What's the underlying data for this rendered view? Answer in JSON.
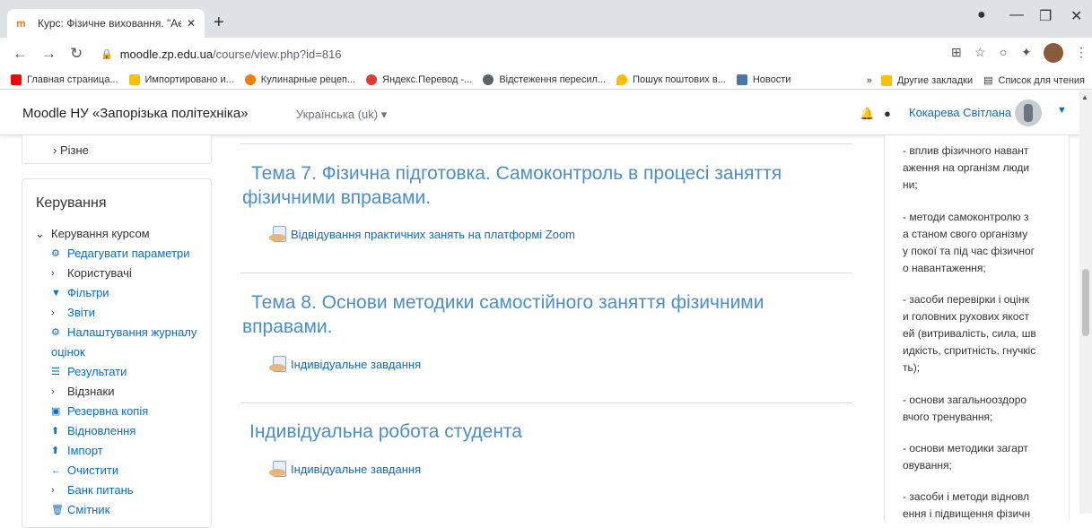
{
  "browser": {
    "tab_title": "Курс: Фізичне виховання. \"Аеро",
    "address_host": "moodle.zp.edu.ua",
    "address_path": "/course/view.php?id=816",
    "bookmarks": [
      {
        "label": "Главная страница...",
        "color": "#ff0000"
      },
      {
        "label": "Импортировано и...",
        "color": "#f4c20d"
      },
      {
        "label": "Кулинарные рецеп...",
        "color": "#f57c00"
      },
      {
        "label": "Яндекс.Перевод -...",
        "color": "#e53935"
      },
      {
        "label": "Відстеження пересил...",
        "color": "#5f6368"
      },
      {
        "label": "Пошук поштових в...",
        "color": "#fbbc04"
      },
      {
        "label": "Новости",
        "color": "#4a76a8"
      }
    ],
    "bookmarks_more": "»",
    "other_bookmarks": "Другие закладки",
    "reading_list": "Список для чтения"
  },
  "navbar": {
    "site_name": "Moodle НУ «Запорізька політехніка»",
    "language": "Українська (uk) ▾",
    "user_name": "Кокарева Світлана"
  },
  "left": {
    "prev_item": "Різне",
    "admin_title": "Керування",
    "admin_items": [
      {
        "prefix": "⌄",
        "icon": "",
        "label": "Керування курсом",
        "link": false
      },
      {
        "prefix": "",
        "icon": "⚙",
        "label": "Редагувати параметри",
        "link": true
      },
      {
        "prefix": "›",
        "icon": "",
        "label": "Користувачі",
        "link": false
      },
      {
        "prefix": "",
        "icon": "▼",
        "label": "Фільтри",
        "link": true
      },
      {
        "prefix": "›",
        "icon": "",
        "label": "Звіти",
        "link": true
      },
      {
        "prefix": "",
        "icon": "⚙",
        "label": "Налаштування журналу",
        "link": true
      },
      {
        "prefix": "",
        "icon": "",
        "label": "оцінок",
        "link": true
      },
      {
        "prefix": "",
        "icon": "☰",
        "label": "Результати",
        "link": true
      },
      {
        "prefix": "›",
        "icon": "",
        "label": "Відзнаки",
        "link": false
      },
      {
        "prefix": "",
        "icon": "▣",
        "label": "Резервна копія",
        "link": true
      },
      {
        "prefix": "",
        "icon": "⬆",
        "label": "Відновлення",
        "link": true
      },
      {
        "prefix": "",
        "icon": "⬆",
        "label": "Імпорт",
        "link": true
      },
      {
        "prefix": "",
        "icon": "←",
        "label": "Очистити",
        "link": true
      },
      {
        "prefix": "›",
        "icon": "",
        "label": "Банк питань",
        "link": true
      },
      {
        "prefix": "",
        "icon": "🗑",
        "label": "Смітник",
        "link": true
      }
    ]
  },
  "main": {
    "sections": [
      {
        "title_line1": "Тема 7. Фізична підготовка. Самоконтроль в процесі заняття",
        "title_line2": "фізичними вправами.",
        "activity": "Відвідування практичних занять на платформі Zoom"
      },
      {
        "title_line1": "Тема 8. Основи методики самостійного заняття фізичними",
        "title_line2": "вправами.",
        "activity": "Індивідуальне завдання"
      },
      {
        "title_line1": "Індивідуальна робота студента",
        "title_line2": "",
        "activity": "Індивідуальне завдання"
      }
    ]
  },
  "right": {
    "paragraphs": [
      [
        "- вплив фізичного навант",
        "аження на організм люди",
        "ни;"
      ],
      [
        "- методи самоконтролю з",
        "а станом свого організму",
        "у покої та під час фізичног",
        "о навантаження;"
      ],
      [
        "- засоби перевірки і оцінк",
        "и головних рухових якост",
        "ей (витривалість, сила, шв",
        "идкість, спритність, гнучкіс",
        "ть);"
      ],
      [
        "- основи загальнооздоро",
        "вчого тренування;"
      ],
      [
        "- основи методики загарт",
        "овування;"
      ],
      [
        "- засоби і методи відновл",
        "ення і підвищення фізичн"
      ]
    ]
  }
}
